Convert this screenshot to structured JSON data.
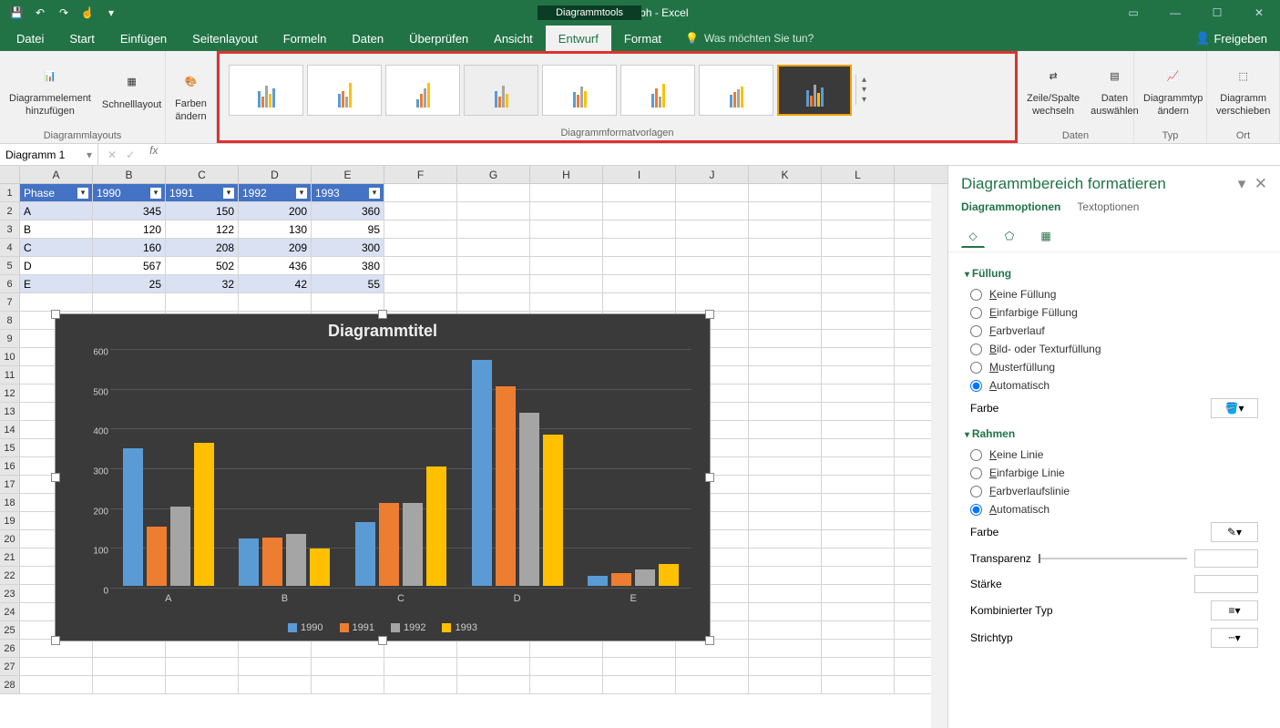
{
  "app": {
    "title": "Excel Graph - Excel",
    "contextTools": "Diagrammtools"
  },
  "winControls": {
    "ribbonOpts": "▭",
    "min": "—",
    "max": "☐",
    "close": "✕"
  },
  "tabs": [
    "Datei",
    "Start",
    "Einfügen",
    "Seitenlayout",
    "Formeln",
    "Daten",
    "Überprüfen",
    "Ansicht",
    "Entwurf",
    "Format"
  ],
  "activeTab": "Entwurf",
  "tellMe": "Was möchten Sie tun?",
  "share": "Freigeben",
  "ribbon": {
    "layoutsGroup": "Diagrammlayouts",
    "addElement": "Diagrammelement hinzufügen",
    "quickLayout": "Schnelllayout",
    "changeColors": "Farben ändern",
    "stylesGroup": "Diagrammformatvorlagen",
    "switchRowCol": "Zeile/Spalte wechseln",
    "selectData": "Daten auswählen",
    "dataGroup": "Daten",
    "changeType": "Diagrammtyp ändern",
    "typeGroup": "Typ",
    "moveChart": "Diagramm verschieben",
    "locationGroup": "Ort"
  },
  "nameBox": "Diagramm 1",
  "columns": [
    "A",
    "B",
    "C",
    "D",
    "E",
    "F",
    "G",
    "H",
    "I",
    "J",
    "K",
    "L"
  ],
  "table": {
    "headers": [
      "Phase",
      "1990",
      "1991",
      "1992",
      "1993"
    ],
    "rows": [
      {
        "phase": "A",
        "v": [
          345,
          150,
          200,
          360
        ]
      },
      {
        "phase": "B",
        "v": [
          120,
          122,
          130,
          95
        ]
      },
      {
        "phase": "C",
        "v": [
          160,
          208,
          209,
          300
        ]
      },
      {
        "phase": "D",
        "v": [
          567,
          502,
          436,
          380
        ]
      },
      {
        "phase": "E",
        "v": [
          25,
          32,
          42,
          55
        ]
      }
    ]
  },
  "chart_data": {
    "type": "bar",
    "title": "Diagrammtitel",
    "categories": [
      "A",
      "B",
      "C",
      "D",
      "E"
    ],
    "series": [
      {
        "name": "1990",
        "color": "#5b9bd5",
        "values": [
          345,
          120,
          160,
          567,
          25
        ]
      },
      {
        "name": "1991",
        "color": "#ed7d31",
        "values": [
          150,
          122,
          208,
          502,
          32
        ]
      },
      {
        "name": "1992",
        "color": "#a5a5a5",
        "values": [
          200,
          130,
          209,
          436,
          42
        ]
      },
      {
        "name": "1993",
        "color": "#ffc000",
        "values": [
          360,
          95,
          300,
          380,
          55
        ]
      }
    ],
    "ylim": [
      0,
      600
    ],
    "yticks": [
      0,
      100,
      200,
      300,
      400,
      500,
      600
    ]
  },
  "taskpane": {
    "title": "Diagrammbereich formatieren",
    "tab1": "Diagrammoptionen",
    "tab2": "Textoptionen",
    "fillSection": "Füllung",
    "fillOptions": [
      "Keine Füllung",
      "Einfarbige Füllung",
      "Farbverlauf",
      "Bild- oder Texturfüllung",
      "Musterfüllung",
      "Automatisch"
    ],
    "fillSelected": "Automatisch",
    "colorLabel": "Farbe",
    "borderSection": "Rahmen",
    "borderOptions": [
      "Keine Linie",
      "Einfarbige Linie",
      "Farbverlaufslinie",
      "Automatisch"
    ],
    "borderSelected": "Automatisch",
    "transparency": "Transparenz",
    "width": "Stärke",
    "compound": "Kombinierter Typ",
    "dash": "Strichtyp"
  }
}
